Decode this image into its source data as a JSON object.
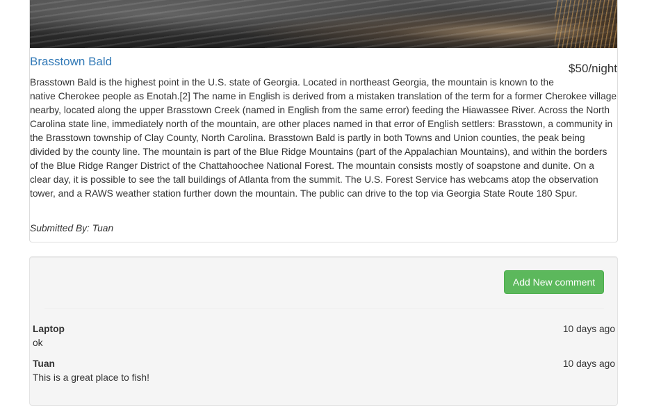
{
  "campground": {
    "image_alt": "Brasstown Bald",
    "title": "Brasstown Bald",
    "price": "$50/night",
    "description": "Brasstown Bald is the highest point in the U.S. state of Georgia. Located in northeast Georgia, the mountain is known to the native Cherokee people as Enotah.[2] The name in English is derived from a mistaken translation of the term for a former Cherokee village nearby, located along the upper Brasstown Creek (named in English from the same error) feeding the Hiawassee River. Across the North Carolina state line, immediately north of the mountain, are other places named in that error of English settlers: Brasstown, a community in the Brasstown township of Clay County, North Carolina. Brasstown Bald is partly in both Towns and Union counties, the peak being divided by the county line. The mountain is part of the Blue Ridge Mountains (part of the Appalachian Mountains), and within the borders of the Blue Ridge Ranger District of the Chattahoochee National Forest. The mountain consists mostly of soapstone and dunite. On a clear day, it is possible to see the tall buildings of Atlanta from the summit. The U.S. Forest Service has webcams atop the observation tower, and a RAWS weather station further down the mountain. The public can drive to the top via Georgia State Route 180 Spur.",
    "submitted_by": "Submitted By: Tuan"
  },
  "comments_panel": {
    "add_button_label": "Add New comment",
    "comments": [
      {
        "author": "Laptop",
        "time": "10 days ago",
        "text": "ok"
      },
      {
        "author": "Tuan",
        "time": "10 days ago",
        "text": "This is a great place to fish!"
      }
    ]
  },
  "colors": {
    "link": "#337ab7",
    "success_button": "#5cb85c",
    "well_background": "#f5f5f5"
  }
}
